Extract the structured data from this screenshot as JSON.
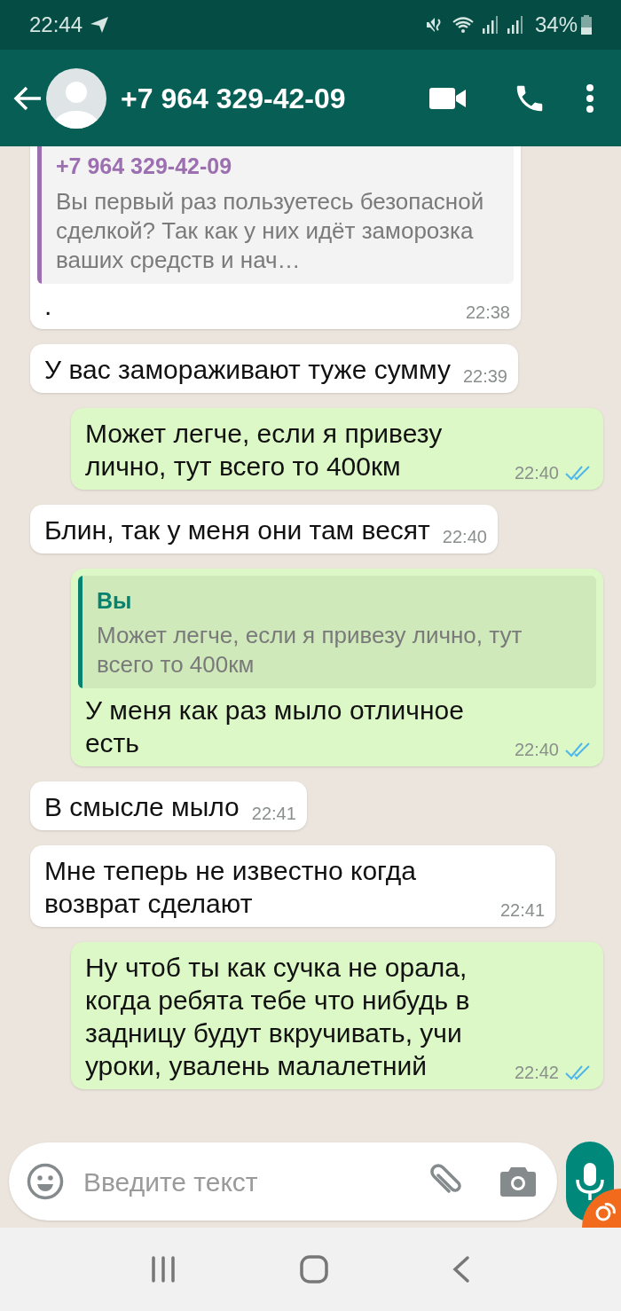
{
  "status_bar": {
    "time": "22:44",
    "battery": "34%"
  },
  "header": {
    "title": "+7 964 329-42-09"
  },
  "messages": [
    {
      "kind": "incoming",
      "quote": {
        "author": "+7 964 329-42-09",
        "text": "Вы первый раз пользуетесь безопасной сделкой? Так как у них идёт заморозка ваших средств и нач…"
      },
      "text": ".",
      "time": "22:38"
    },
    {
      "kind": "incoming",
      "text": "У вас замораживают туже сумму",
      "time": "22:39"
    },
    {
      "kind": "outgoing",
      "text": "Может легче, если я привезу лично, тут всего то 400км",
      "time": "22:40",
      "read": true
    },
    {
      "kind": "incoming",
      "text": "Блин, так у меня они там весят",
      "time": "22:40"
    },
    {
      "kind": "outgoing",
      "quote": {
        "author": "Вы",
        "text": "Может легче, если я привезу лично, тут всего то 400км"
      },
      "text": "У меня как раз мыло отличное есть",
      "time": "22:40",
      "read": true
    },
    {
      "kind": "incoming",
      "text": "В смысле мыло",
      "time": "22:41"
    },
    {
      "kind": "incoming",
      "text": "Мне теперь не известно когда возврат сделают",
      "time": "22:41"
    },
    {
      "kind": "outgoing",
      "text": "Ну чтоб ты как сучка не орала, когда ребята тебе что нибудь в задницу будут вкручивать, учи уроки, увалень малалетний",
      "time": "22:42",
      "read": true
    }
  ],
  "composer": {
    "placeholder": "Введите текст"
  }
}
